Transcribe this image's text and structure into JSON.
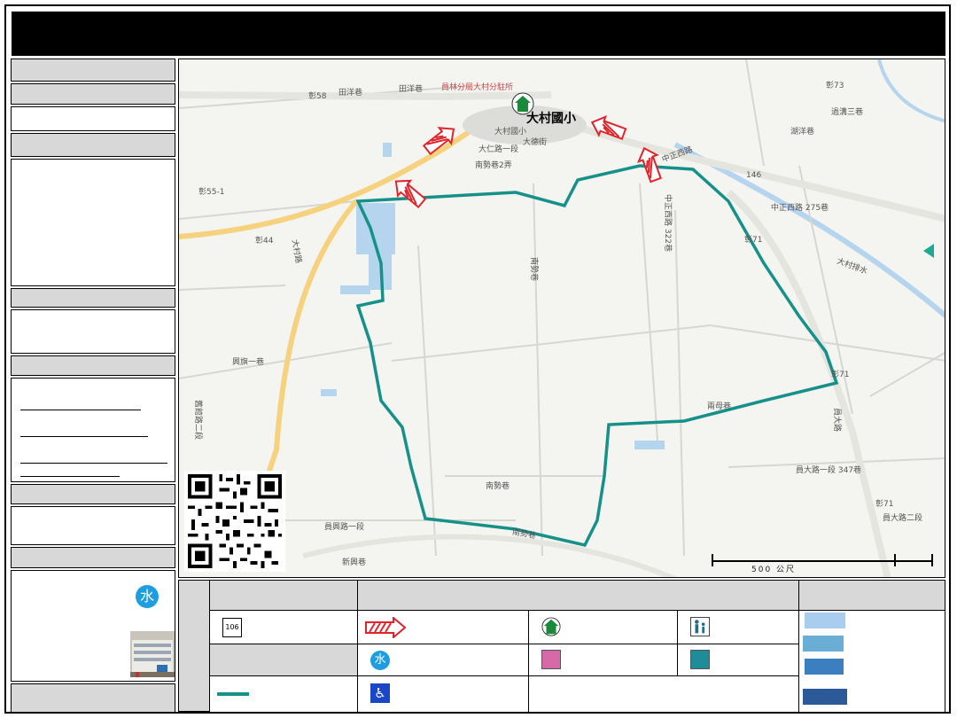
{
  "map": {
    "school_label": "大村國小",
    "labels": {
      "police": "員林分局大村分駐所",
      "tianyang": "田洋巷",
      "tianyang2": "田洋巷",
      "zhang58": "彰58",
      "zhang73": "彰73",
      "zhang55_1": "彰55-1",
      "zhang44": "彰44",
      "zhang71a": "彰71",
      "zhang71b": "彰71",
      "zhang71c": "彰71",
      "r146": "146",
      "zhongzheng_w": "中正西路",
      "zhongzheng_w275": "中正西路 275巷",
      "zhongzheng_w322": "中正西路 322巷",
      "dacun_rd": "大村路",
      "dacun_school_small": "大村國小",
      "daren1": "大仁路一段",
      "daren_st": "大德街",
      "nanshi2": "南勢巷2弄",
      "nanshi": "南勢巷",
      "nanshi_b": "南勢巷",
      "nanshi_c": "南勢巷",
      "yuandalu": "員大路",
      "yuandalu2": "員大路二段",
      "yuandalu347": "員大路一段 347巷",
      "huxiang": "湖洋巷",
      "guqi": "過溝三巷",
      "xingqi": "興旗一巷",
      "xinxing": "新興巷",
      "jiuguan": "舊館路二段",
      "yuanxing": "員興路一段",
      "dacun_canal": "大村排水",
      "liangmu": "兩母巷",
      "scale_label": "500 公尺"
    }
  },
  "legend": {
    "road_badge": "106"
  },
  "colors": {
    "boundary": "#16918a",
    "arrow_red": "#e0242a",
    "road_yellow": "#f6d27e",
    "water_blue": "#b5d4ee",
    "legend_swatches": [
      "#a9cdee",
      "#6aaed6",
      "#3b7fc1",
      "#2c5a98"
    ]
  },
  "icons": {
    "water_tower": "water-tap-icon",
    "school": "school-icon",
    "family": "family-icon",
    "nursing": "nursing-room-icon",
    "baby": "baby-changing-icon",
    "accessible": "wheelchair-icon"
  }
}
